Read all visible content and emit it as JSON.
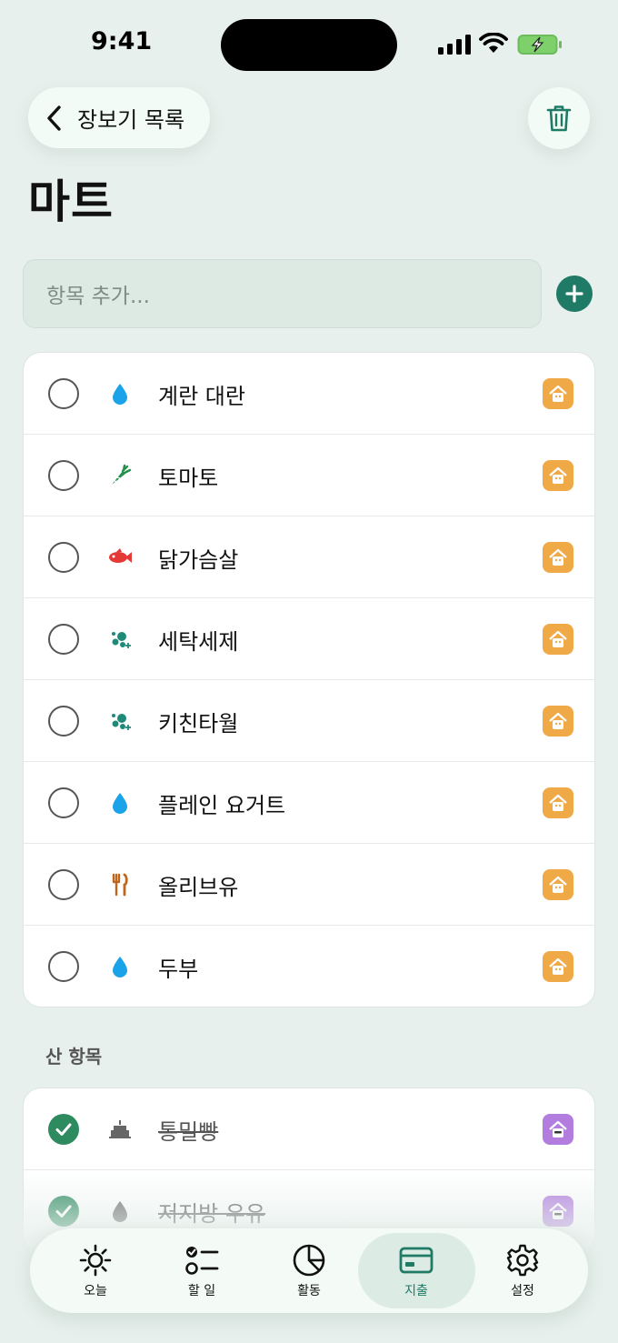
{
  "status_bar": {
    "time": "9:41"
  },
  "header": {
    "back_label": "장보기 목록",
    "title": "마트"
  },
  "add_item": {
    "placeholder": "항목 추가..."
  },
  "items": [
    {
      "label": "계란 대란",
      "icon": "droplet-icon",
      "checked": false
    },
    {
      "label": "토마토",
      "icon": "carrot-icon",
      "checked": false
    },
    {
      "label": "닭가슴살",
      "icon": "fish-icon",
      "checked": false
    },
    {
      "label": "세탁세제",
      "icon": "bubbles-icon",
      "checked": false
    },
    {
      "label": "키친타월",
      "icon": "bubbles-icon",
      "checked": false
    },
    {
      "label": "플레인 요거트",
      "icon": "droplet-icon",
      "checked": false
    },
    {
      "label": "올리브유",
      "icon": "utensils-icon",
      "checked": false
    },
    {
      "label": "두부",
      "icon": "droplet-icon",
      "checked": false
    }
  ],
  "purchased_section": {
    "label": "산 항목",
    "items": [
      {
        "label": "통밀빵",
        "icon": "cake-icon",
        "checked": true
      },
      {
        "label": "저지방 우유",
        "icon": "droplet-icon",
        "checked": true
      }
    ]
  },
  "tabs": [
    {
      "label": "오늘",
      "icon": "sun-icon"
    },
    {
      "label": "할 일",
      "icon": "checklist-icon"
    },
    {
      "label": "활동",
      "icon": "pie-chart-icon"
    },
    {
      "label": "지출",
      "icon": "card-icon",
      "active": true
    },
    {
      "label": "설정",
      "icon": "gear-icon"
    }
  ],
  "colors": {
    "background": "#e7f0ec",
    "accent": "#1f7a66",
    "check_done": "#2e8a5f",
    "badge_orange": "#f0a947",
    "badge_purple": "#b37de0"
  }
}
